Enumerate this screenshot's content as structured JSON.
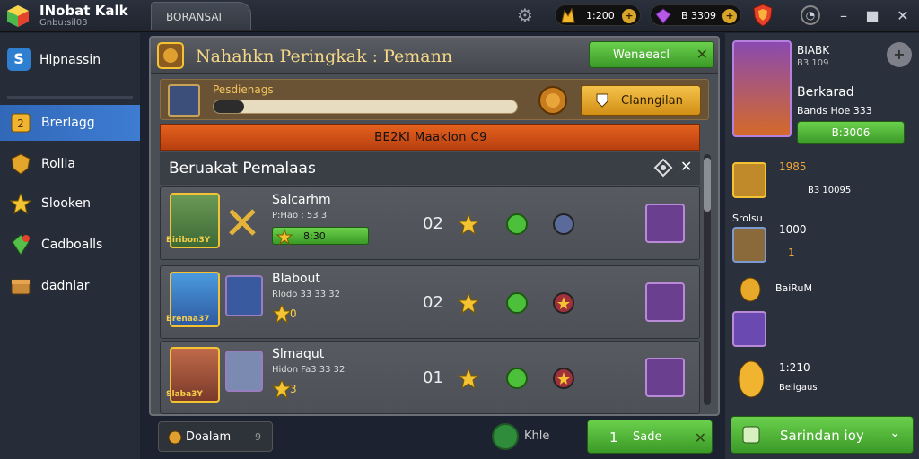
{
  "app": {
    "name": "INobat Kalk",
    "sub": "Gnbu:sil03"
  },
  "top_tab": "BORANSAI",
  "resources": {
    "gold": "1:200",
    "gems": "B 3309"
  },
  "icons": {
    "gear": "gear-icon",
    "shield": "shield-icon",
    "close": "close-icon",
    "minimize": "minimize-icon",
    "maximize": "maximize-icon"
  },
  "sidebar": {
    "header": "Hlpnassin",
    "items": [
      {
        "label": "Brerlagg",
        "icon": "badge-icon",
        "active": true
      },
      {
        "label": "Rollia",
        "icon": "shield-icon",
        "active": false
      },
      {
        "label": "Slooken",
        "icon": "star-icon",
        "active": false
      },
      {
        "label": "Cadboalls",
        "icon": "gem-icon",
        "active": false
      },
      {
        "label": "dadnlar",
        "icon": "chest-icon",
        "active": false
      }
    ]
  },
  "panel": {
    "title": "Nahahkn Peringkak : Pemann",
    "head_button": "Wenaeacl",
    "progress": {
      "label": "Pesdienags",
      "fill": 0.1,
      "claim_label": "Clanngilan"
    },
    "banner": "BE2KI Maaklon C9",
    "list_title": "Beruakat Pemalaas",
    "rows": [
      {
        "name": "Salcarhm",
        "sub": "P:Hao : 53 3",
        "tag": "Biribon3Y",
        "bar_text": "8:30",
        "count": "02"
      },
      {
        "name": "Blabout",
        "sub": "Rlodo 33 33 32",
        "tag": "Brenaa37",
        "star_num": "0",
        "count": "02"
      },
      {
        "name": "Slmaqut",
        "sub": "Hidon Fa3 33 32",
        "tag": "Slaba3Y",
        "star_num": "3",
        "count": "01"
      }
    ]
  },
  "footer": {
    "left_label": "Doalam",
    "left_num": "9",
    "dot_label": "Khle",
    "btn_num": "1",
    "btn_label": "Sade"
  },
  "right": {
    "label1": "BIABK",
    "label2": "B3 109",
    "title": "Berkarad",
    "sub": "Bands Hoe 333",
    "btn": "B:3006",
    "items": [
      {
        "a": "1985",
        "b": "B3 10095"
      },
      {
        "a": "Srolsu",
        "b": "1000"
      },
      {
        "a": "1",
        "b": ""
      },
      {
        "a": "BaiRuM",
        "b": ""
      },
      {
        "a": "1:210",
        "b": "Beligaus"
      }
    ],
    "bottom_btn": "Sarindan ioy"
  },
  "colors": {
    "accent": "#3e7cd2",
    "green": "#4aae30",
    "orange": "#e5621e",
    "gold": "#f3c334"
  }
}
